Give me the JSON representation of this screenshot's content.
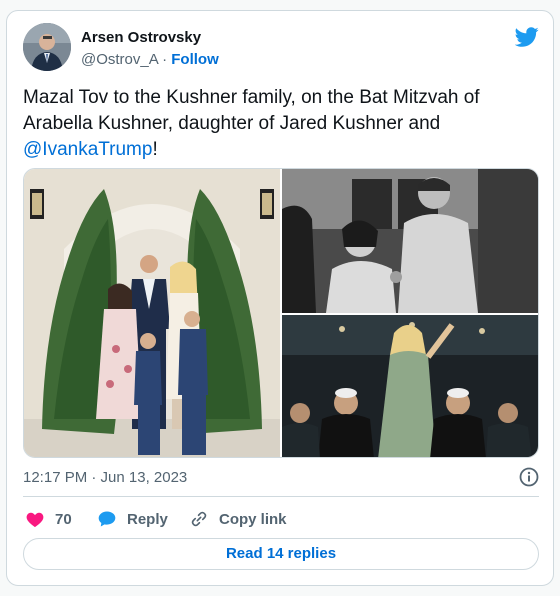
{
  "author": {
    "name": "Arsen Ostrovsky",
    "handle": "@Ostrov_A",
    "separator": "·",
    "follow_label": "Follow"
  },
  "tweet": {
    "text_part1": "Mazal Tov to the Kushner family, on the Bat Mitzvah of Arabella Kushner, daughter of Jared Kushner and ",
    "mention": "@IvankaTrump",
    "text_part2": "!"
  },
  "media": {
    "photos": [
      "family-portrait",
      "dance-photo",
      "celebration-photo"
    ]
  },
  "meta": {
    "timestamp": "12:17 PM · Jun 13, 2023"
  },
  "actions": {
    "like_count": "70",
    "reply_label": "Reply",
    "copy_link_label": "Copy link"
  },
  "footer": {
    "read_replies_label": "Read 14 replies"
  },
  "colors": {
    "accent": "#006fd6",
    "like": "#f91880",
    "reply": "#1d9bf0",
    "muted": "#536471",
    "border": "#cfd9de"
  },
  "icons": [
    "twitter-bird-icon",
    "info-icon",
    "heart-icon",
    "reply-bubble-icon",
    "link-icon"
  ]
}
